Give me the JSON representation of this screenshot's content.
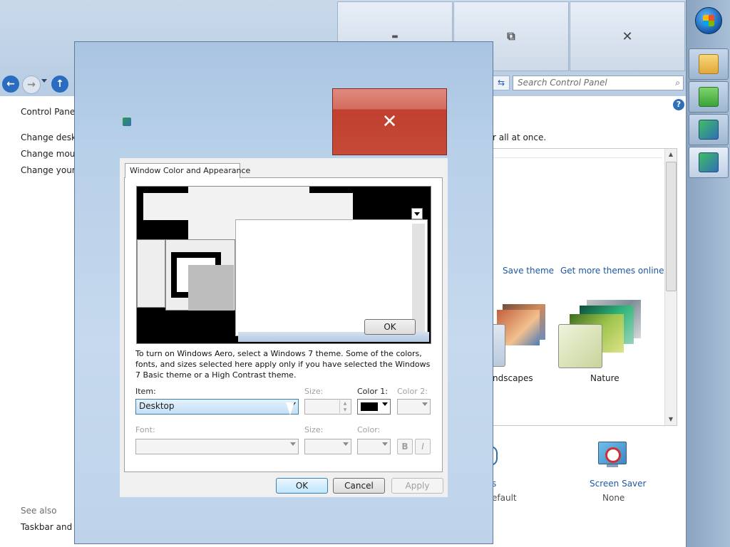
{
  "background_window": {
    "search_placeholder": "Search Control Panel",
    "breadcrumb": "Control Panel",
    "left_links": [
      "Change deskto",
      "Change mous",
      "Change your a"
    ],
    "see_also_heading": "See also",
    "see_also_link": "Taskbar and St",
    "header_text": "r all at once.",
    "save_theme": "Save theme",
    "more_themes": "Get more themes online",
    "themes": [
      {
        "label": "ndscapes"
      },
      {
        "label": "Nature"
      }
    ],
    "bottom_items": [
      {
        "label": "s",
        "value": "efault"
      },
      {
        "label": "Screen Saver",
        "value": "None"
      }
    ]
  },
  "dialog": {
    "tab_label": "Window Color and Appearance",
    "preview_ok": "OK",
    "description": "To turn on Windows Aero, select a Windows 7 theme.  Some of the colors, fonts, and sizes selected here apply only if you have selected the Windows 7 Basic theme or a High Contrast theme.",
    "item_label": "Item:",
    "item_value": "Desktop",
    "size_label": "Size:",
    "color1_label": "Color 1:",
    "color2_label": "Color 2:",
    "font_label": "Font:",
    "font_size_label": "Size:",
    "font_color_label": "Color:",
    "bold_label": "B",
    "italic_label": "I",
    "ok_label": "OK",
    "cancel_label": "Cancel",
    "apply_label": "Apply",
    "color1_hex": "#000000"
  },
  "caption_glyphs": {
    "minimize": "▬",
    "restore": "⧉",
    "close": "✕"
  }
}
